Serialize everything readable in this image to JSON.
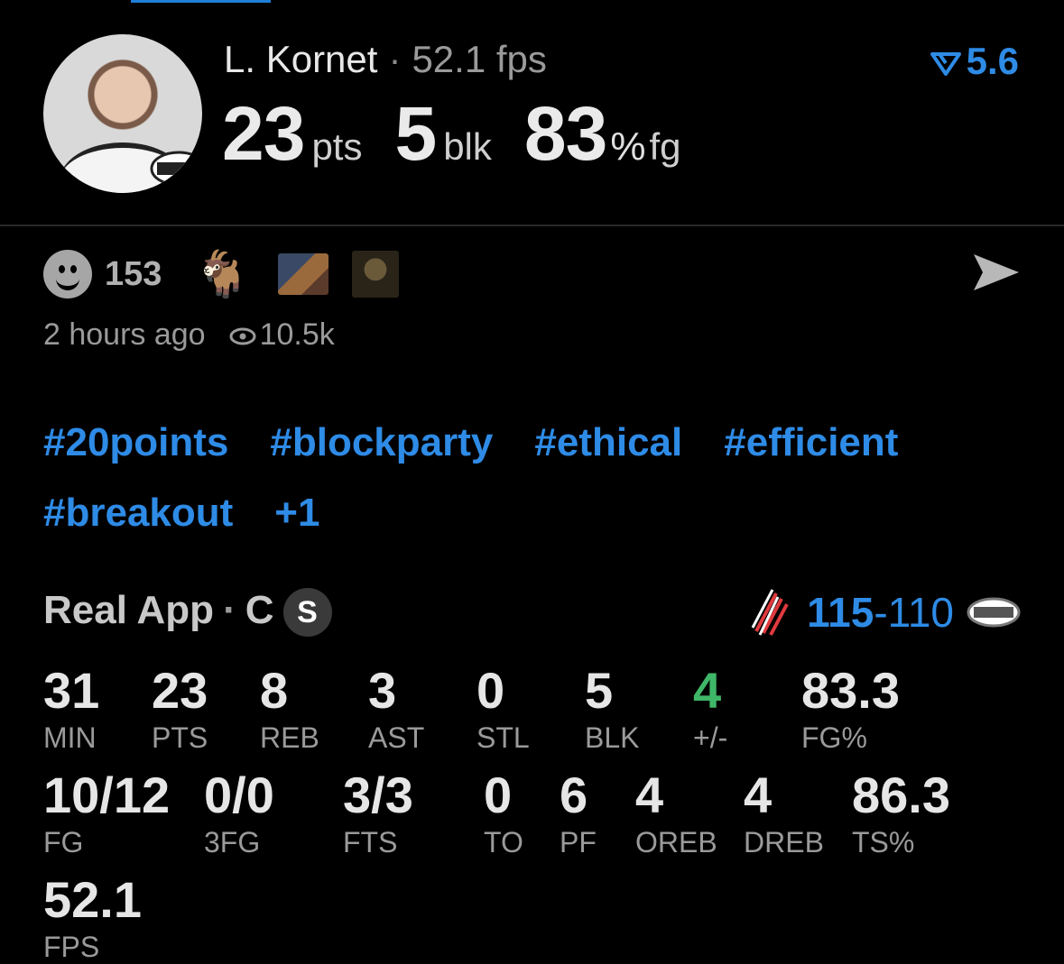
{
  "header": {
    "player_name": "L. Kornet",
    "separator": "·",
    "fps_label": "52.1 fps",
    "rank_value": "5.6",
    "big_stats": [
      {
        "value": "23",
        "unit": "pts"
      },
      {
        "value": "5",
        "unit": "blk"
      },
      {
        "value": "83",
        "unit": "fg",
        "percent": "%"
      }
    ]
  },
  "reactions": {
    "count": "153",
    "emoji_goat": "🐐"
  },
  "meta": {
    "time_ago": "2 hours ago",
    "views": "10.5k"
  },
  "tags": [
    "#20points",
    "#blockparty",
    "#ethical",
    "#efficient",
    "#breakout",
    "+1"
  ],
  "source": {
    "app": "Real App",
    "position": "C",
    "badge": "S",
    "score_win": "115",
    "score_dash": "-",
    "score_lose": "110"
  },
  "stats_row1": [
    {
      "v": "31",
      "l": "MIN"
    },
    {
      "v": "23",
      "l": "PTS"
    },
    {
      "v": "8",
      "l": "REB"
    },
    {
      "v": "3",
      "l": "AST"
    },
    {
      "v": "0",
      "l": "STL"
    },
    {
      "v": "5",
      "l": "BLK"
    },
    {
      "v": "4",
      "l": "+/-"
    },
    {
      "v": "83.3",
      "l": "FG%"
    }
  ],
  "stats_row2": [
    {
      "v": "10/12",
      "l": "FG"
    },
    {
      "v": "0/0",
      "l": "3FG"
    },
    {
      "v": "3/3",
      "l": "FTS"
    },
    {
      "v": "0",
      "l": "TO"
    },
    {
      "v": "6",
      "l": "PF"
    },
    {
      "v": "4",
      "l": "OREB"
    },
    {
      "v": "4",
      "l": "DREB"
    },
    {
      "v": "86.3",
      "l": "TS%"
    }
  ],
  "stats_row3": [
    {
      "v": "52.1",
      "l": "FPS"
    }
  ],
  "colors": {
    "accent": "#2e8be6",
    "positive": "#3fb768",
    "background": "#000000"
  }
}
